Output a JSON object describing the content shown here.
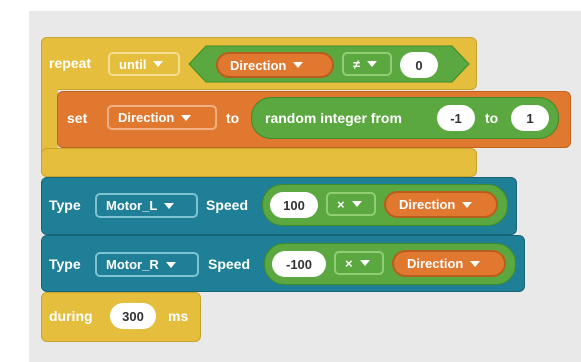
{
  "repeat_block": {
    "keyword": "repeat",
    "mode": "until",
    "variable": "Direction",
    "operator": "≠",
    "value": "0"
  },
  "set_block": {
    "keyword": "set",
    "variable": "Direction",
    "to_label": "to",
    "random_label": "random integer from",
    "from": "-1",
    "to_word": "to",
    "to_value": "1"
  },
  "motor_l_block": {
    "type_label": "Type",
    "motor": "Motor_L",
    "speed_label": "Speed",
    "value": "100",
    "operator": "×",
    "variable": "Direction"
  },
  "motor_r_block": {
    "type_label": "Type",
    "motor": "Motor_R",
    "speed_label": "Speed",
    "value": "-100",
    "operator": "×",
    "variable": "Direction"
  },
  "during_block": {
    "keyword": "during",
    "value": "300",
    "unit": "ms"
  },
  "colors": {
    "control": "#e4be3c",
    "variable": "#e0782f",
    "operator": "#5ba840",
    "motor": "#1e7f96"
  }
}
